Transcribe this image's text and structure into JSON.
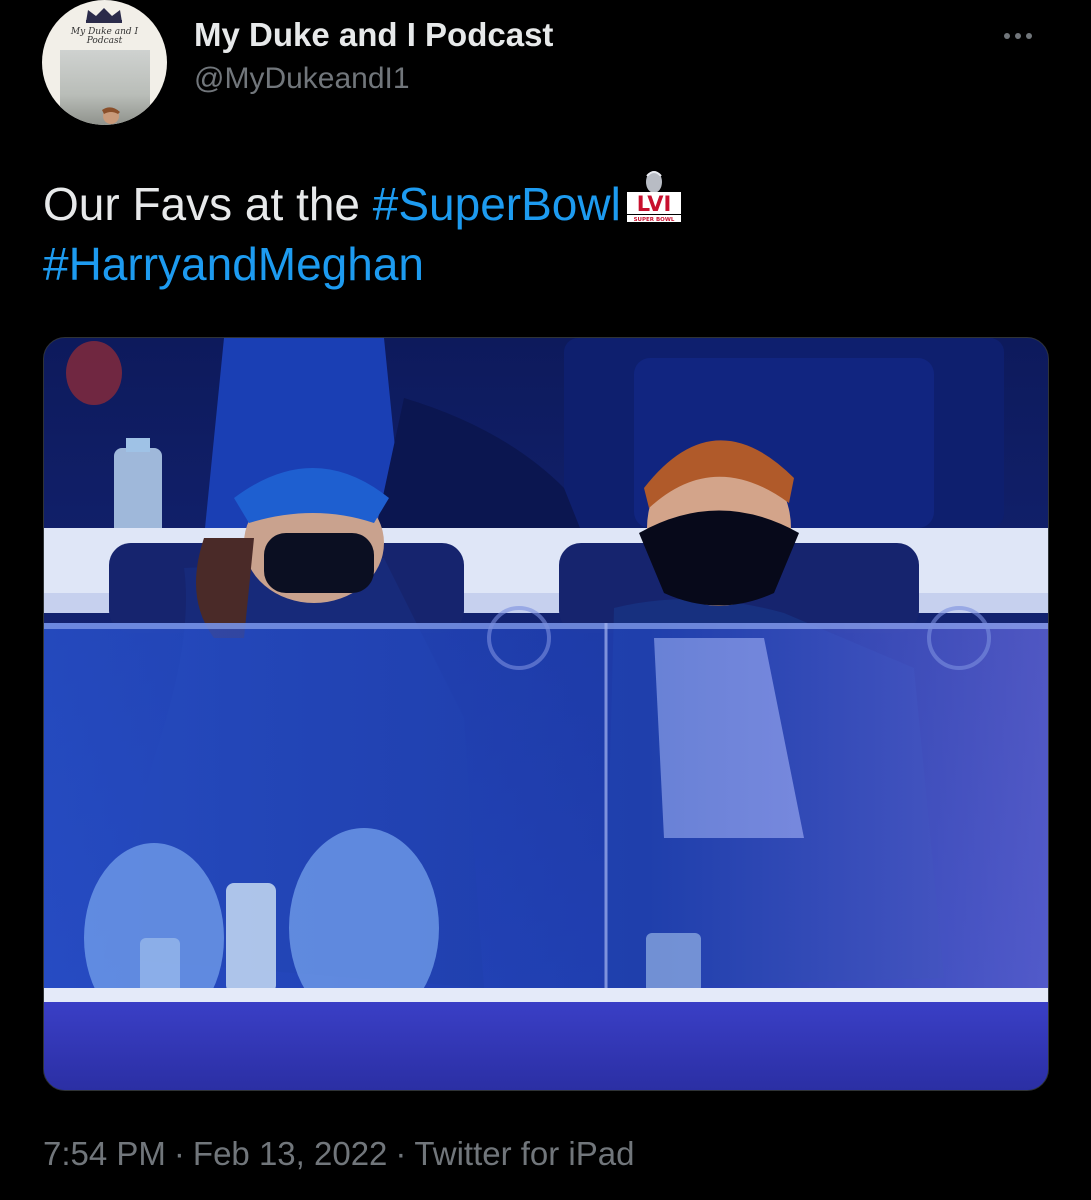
{
  "author": {
    "display_name": "My Duke and I Podcast",
    "handle": "@MyDukeandI1",
    "avatar_text": "My Duke and I Podcast"
  },
  "tweet": {
    "text_plain": "Our Favs at the ",
    "hashtag_1": "#SuperBowl",
    "hashtag_2": "#HarryandMeghan",
    "emoji_icon": "super-bowl-lvi-logo-icon",
    "emoji_text": "LVI",
    "emoji_subtext": "SUPER BOWL"
  },
  "media": {
    "type": "photo",
    "description_icon": "stadium-suite-photo"
  },
  "meta": {
    "time": "7:54 PM",
    "date": "Feb 13, 2022",
    "source": "Twitter for iPad",
    "separator": "·"
  },
  "colors": {
    "background": "#000000",
    "text": "#e7e9ea",
    "secondary": "#71767b",
    "link": "#1d9bf0"
  }
}
